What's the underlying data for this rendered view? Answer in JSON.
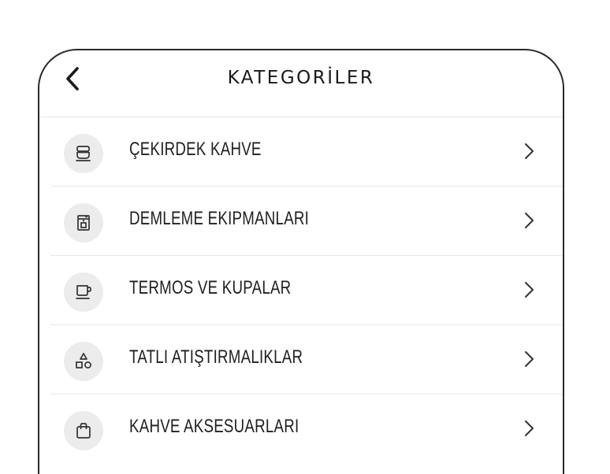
{
  "header": {
    "title": "KATEGORİLER",
    "back_icon": "chevron-left-icon"
  },
  "categories": [
    {
      "label": "ÇEKIRDEK KAHVE",
      "icon": "coffee-bowl-icon"
    },
    {
      "label": "DEMLEME EKIPMANLARI",
      "icon": "coffee-machine-icon"
    },
    {
      "label": "TERMOS VE KUPALAR",
      "icon": "mug-icon"
    },
    {
      "label": "TATLI ATIŞTIRMALIKLAR",
      "icon": "shapes-icon"
    },
    {
      "label": "KAHVE AKSESUARLARI",
      "icon": "shopping-bag-icon"
    }
  ],
  "colors": {
    "text": "#1f1f1f",
    "icon_bg": "#ececec",
    "divider": "#e8e8e8",
    "frame": "#2a2a2a"
  }
}
